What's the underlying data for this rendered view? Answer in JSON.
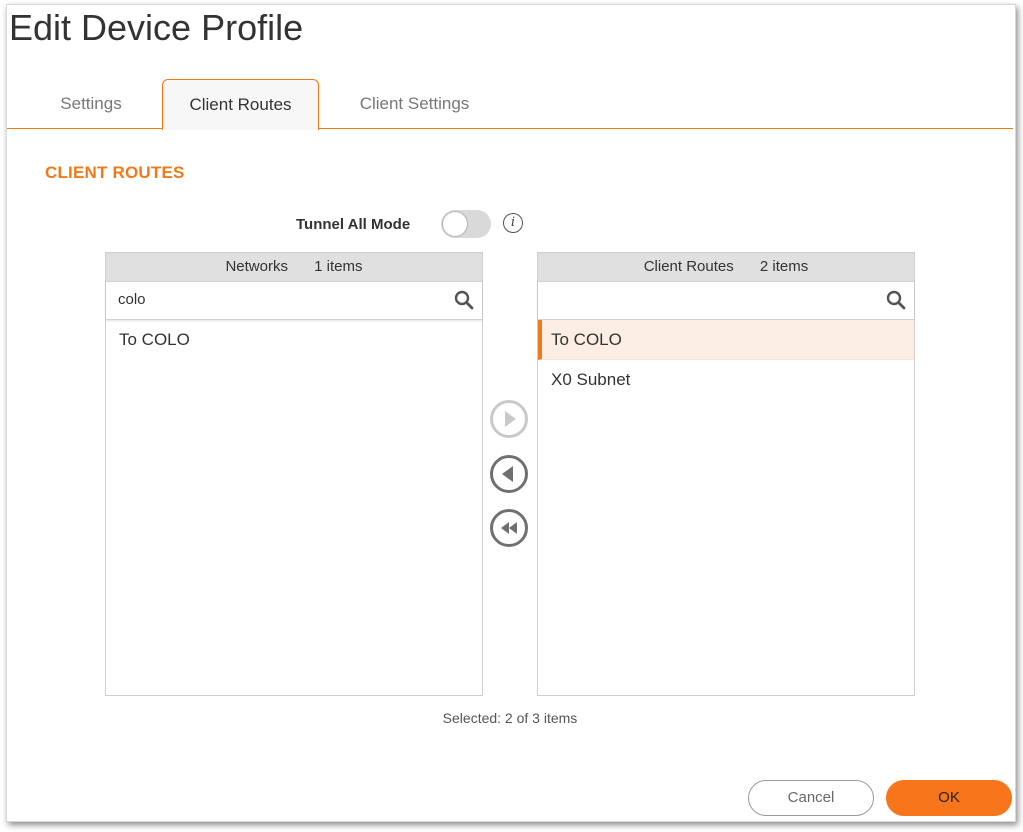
{
  "dialog": {
    "title": "Edit Device Profile"
  },
  "tabs": [
    {
      "label": "Settings"
    },
    {
      "label": "Client Routes",
      "active": true
    },
    {
      "label": "Client Settings"
    }
  ],
  "section": {
    "title": "CLIENT ROUTES"
  },
  "tunnel_all_mode": {
    "label": "Tunnel All Mode",
    "enabled": false,
    "info_icon": "info-icon",
    "info_glyph": "i"
  },
  "networks_panel": {
    "title": "Networks",
    "count_label": "1 items",
    "search": {
      "value": "colo",
      "placeholder": ""
    },
    "items": [
      {
        "label": "To COLO"
      }
    ]
  },
  "client_routes_panel": {
    "title": "Client Routes",
    "count_label": "2 items",
    "search": {
      "value": "",
      "placeholder": ""
    },
    "items": [
      {
        "label": "To COLO",
        "selected": true
      },
      {
        "label": "X0 Subnet",
        "selected": false
      }
    ]
  },
  "transfer_buttons": [
    {
      "name": "add-icon",
      "enabled": false
    },
    {
      "name": "remove-icon",
      "enabled": true
    },
    {
      "name": "remove-all-icon",
      "enabled": true
    }
  ],
  "status": {
    "selected_text": "Selected: 2 of 3 items"
  },
  "footer": {
    "cancel_label": "Cancel",
    "ok_label": "OK"
  },
  "colors": {
    "accent": "#f07a1a",
    "selected_row_bg": "#fdeee3",
    "ok_button": "#f7761b"
  }
}
